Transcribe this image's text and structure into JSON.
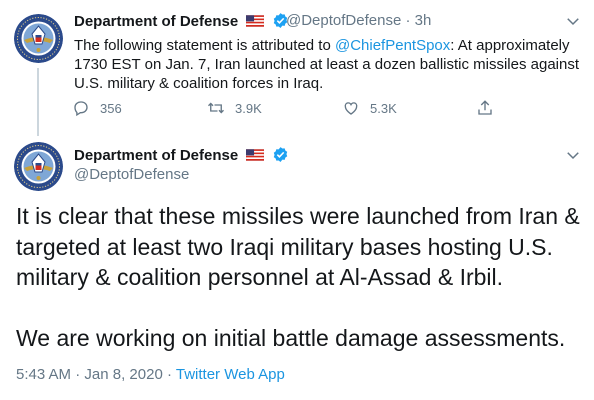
{
  "reply_tweet": {
    "display_name": "Department of Defense",
    "flag_icon": "us-flag-icon",
    "verified_icon": "verified-badge-icon",
    "handle": "@DeptofDefense",
    "separator": "·",
    "time": "3h",
    "text_before": "The following statement is attributed to ",
    "mention": "@ChiefPentSpox",
    "text_after": ": At approximately 1730 EST on Jan. 7, Iran launched at least a dozen ballistic missiles against U.S. military & coalition forces in Iraq.",
    "reply_count": "356",
    "retweet_count": "3.9K",
    "like_count": "5.3K",
    "icons": [
      "reply-icon",
      "retweet-icon",
      "like-icon",
      "share-icon",
      "chevron-down-icon"
    ]
  },
  "main_tweet": {
    "display_name": "Department of Defense",
    "handle": "@DeptofDefense",
    "paragraph_1": "It is clear that these missiles were launched from Iran & targeted at least two Iraqi military bases hosting U.S. military & coalition personnel at Al-Assad & Irbil.",
    "paragraph_2": "We are working on initial battle damage assessments.",
    "time": "5:43 AM",
    "separator": "·",
    "date": "Jan 8, 2020",
    "source": "Twitter Web App"
  },
  "colors": {
    "link": "#1b95e0",
    "muted": "#657786",
    "text": "#14171a",
    "verified": "#1da1f2",
    "seal_blue": "#2b4a8b"
  }
}
